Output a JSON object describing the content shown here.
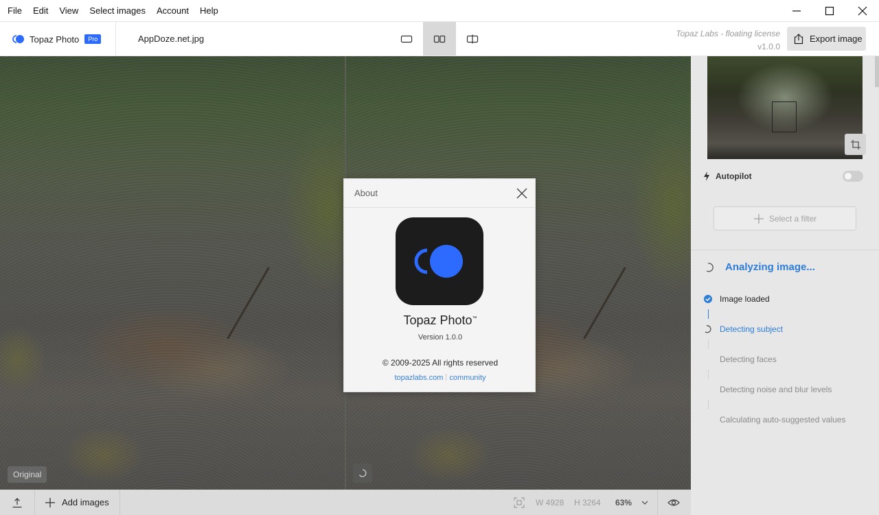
{
  "menu": [
    "File",
    "Edit",
    "View",
    "Select images",
    "Account",
    "Help"
  ],
  "header": {
    "brand_name": "Topaz Photo",
    "brand_badge": "Pro",
    "filename": "AppDoze.net.jpg",
    "license_name": "Topaz Labs - floating license",
    "license_version": "v1.0.0",
    "export_label": "Export image"
  },
  "canvas": {
    "original_label": "Original"
  },
  "panel": {
    "autopilot_label": "Autopilot",
    "filter_label": "Select a filter",
    "analyzing_label": "Analyzing image...",
    "steps": [
      {
        "label": "Image loaded",
        "status": "done"
      },
      {
        "label": "Detecting subject",
        "status": "active"
      },
      {
        "label": "Detecting faces",
        "status": "pending"
      },
      {
        "label": "Detecting noise and blur levels",
        "status": "pending"
      },
      {
        "label": "Calculating auto-suggested values",
        "status": "pending"
      }
    ]
  },
  "bottombar": {
    "add_images_label": "Add images",
    "width_label": "W 4928",
    "height_label": "H 3264",
    "zoom": "63%"
  },
  "about": {
    "title": "About",
    "app_name": "Topaz Photo",
    "trademark": "™",
    "version": "Version 1.0.0",
    "copyright": "© 2009-2025 All rights reserved",
    "link_site": "topazlabs.com",
    "link_community": "community"
  },
  "colors": {
    "accent": "#2d6bff",
    "link": "#3b82d6",
    "analyzing": "#2e7dd7",
    "logo_bg": "#1c1c1c"
  }
}
